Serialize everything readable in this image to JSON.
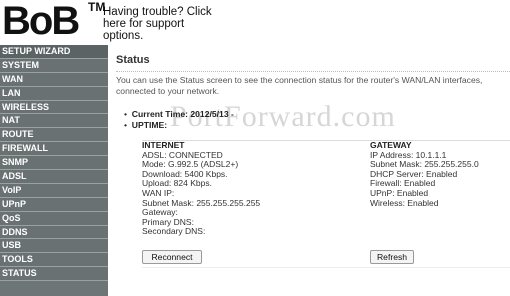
{
  "header": {
    "logo_text": "BoB",
    "tm": "TM",
    "support_link": "Having trouble? Click here for support options."
  },
  "sidebar": {
    "items": [
      {
        "label": "SETUP WIZARD"
      },
      {
        "label": "SYSTEM"
      },
      {
        "label": "WAN"
      },
      {
        "label": "LAN"
      },
      {
        "label": "WIRELESS"
      },
      {
        "label": "NAT"
      },
      {
        "label": "ROUTE"
      },
      {
        "label": "FIREWALL"
      },
      {
        "label": "SNMP"
      },
      {
        "label": "ADSL"
      },
      {
        "label": "VoIP"
      },
      {
        "label": "UPnP"
      },
      {
        "label": "QoS"
      },
      {
        "label": "DDNS"
      },
      {
        "label": "USB"
      },
      {
        "label": "TOOLS"
      },
      {
        "label": "STATUS"
      }
    ]
  },
  "main": {
    "watermark": "PortForward.com",
    "title": "Status",
    "description": "You can use the Status screen to see the connection status for the router's WAN/LAN interfaces, connected to your network.",
    "current_time": "Current Time: 2012/5/13 -",
    "uptime": "UPTIME:",
    "internet": {
      "heading": "INTERNET",
      "lines": [
        "ADSL:  CONNECTED",
        "Mode:  G.992.5 (ADSL2+)",
        "Download:  5400 Kbps.",
        "Upload:  824 Kbps.",
        "WAN IP:",
        "Subnet Mask:  255.255.255.255",
        "Gateway:",
        "Primary DNS:",
        "Secondary DNS:"
      ]
    },
    "gateway": {
      "heading": "GATEWAY",
      "lines": [
        "IP Address:  10.1.1.1",
        "Subnet Mask:  255.255.255.0",
        "DHCP Server:  Enabled",
        "Firewall:  Enabled",
        "UPnP:  Enabled",
        "Wireless:  Enabled"
      ]
    },
    "reconnect_label": "Reconnect",
    "refresh_label": "Refresh"
  }
}
